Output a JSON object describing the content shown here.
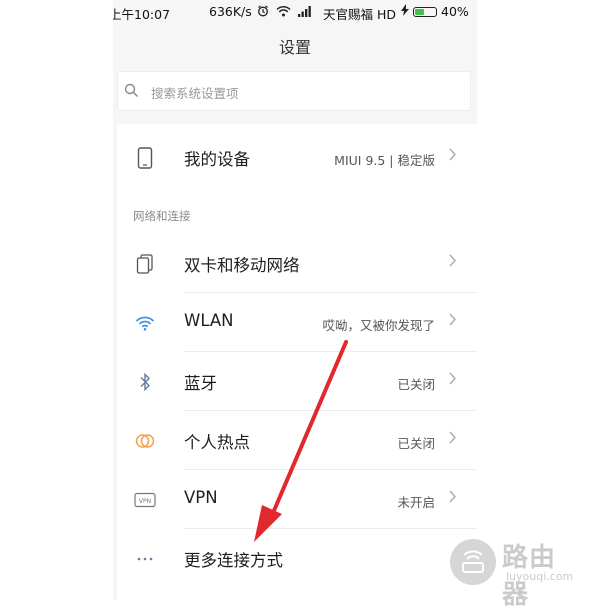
{
  "status_bar": {
    "time": "上午10:07",
    "speed": "636K/s",
    "carrier": "天官赐福 HD",
    "battery": "40%",
    "battery_level": 0.4
  },
  "header": {
    "title": "设置"
  },
  "search": {
    "placeholder": "搜索系统设置项"
  },
  "device": {
    "label": "我的设备",
    "value": "MIUI 9.5 | 稳定版"
  },
  "network": {
    "section_label": "网络和连接",
    "items": [
      {
        "label": "双卡和移动网络",
        "value": "",
        "icon": "dual-sim-icon"
      },
      {
        "label": "WLAN",
        "value": "哎呦，又被你发现了",
        "icon": "wifi-icon"
      },
      {
        "label": "蓝牙",
        "value": "已关闭",
        "icon": "bluetooth-icon"
      },
      {
        "label": "个人热点",
        "value": "已关闭",
        "icon": "hotspot-icon"
      },
      {
        "label": "VPN",
        "value": "未开启",
        "icon": "vpn-icon"
      },
      {
        "label": "更多连接方式",
        "value": "",
        "icon": "more-icon"
      }
    ]
  },
  "watermark": {
    "main": "路由器",
    "sub": "luyouqi.com"
  },
  "colors": {
    "accent_arrow": "#e0282d",
    "wifi_blue": "#3a8ee6",
    "hotspot_orange": "#f0a24a"
  }
}
